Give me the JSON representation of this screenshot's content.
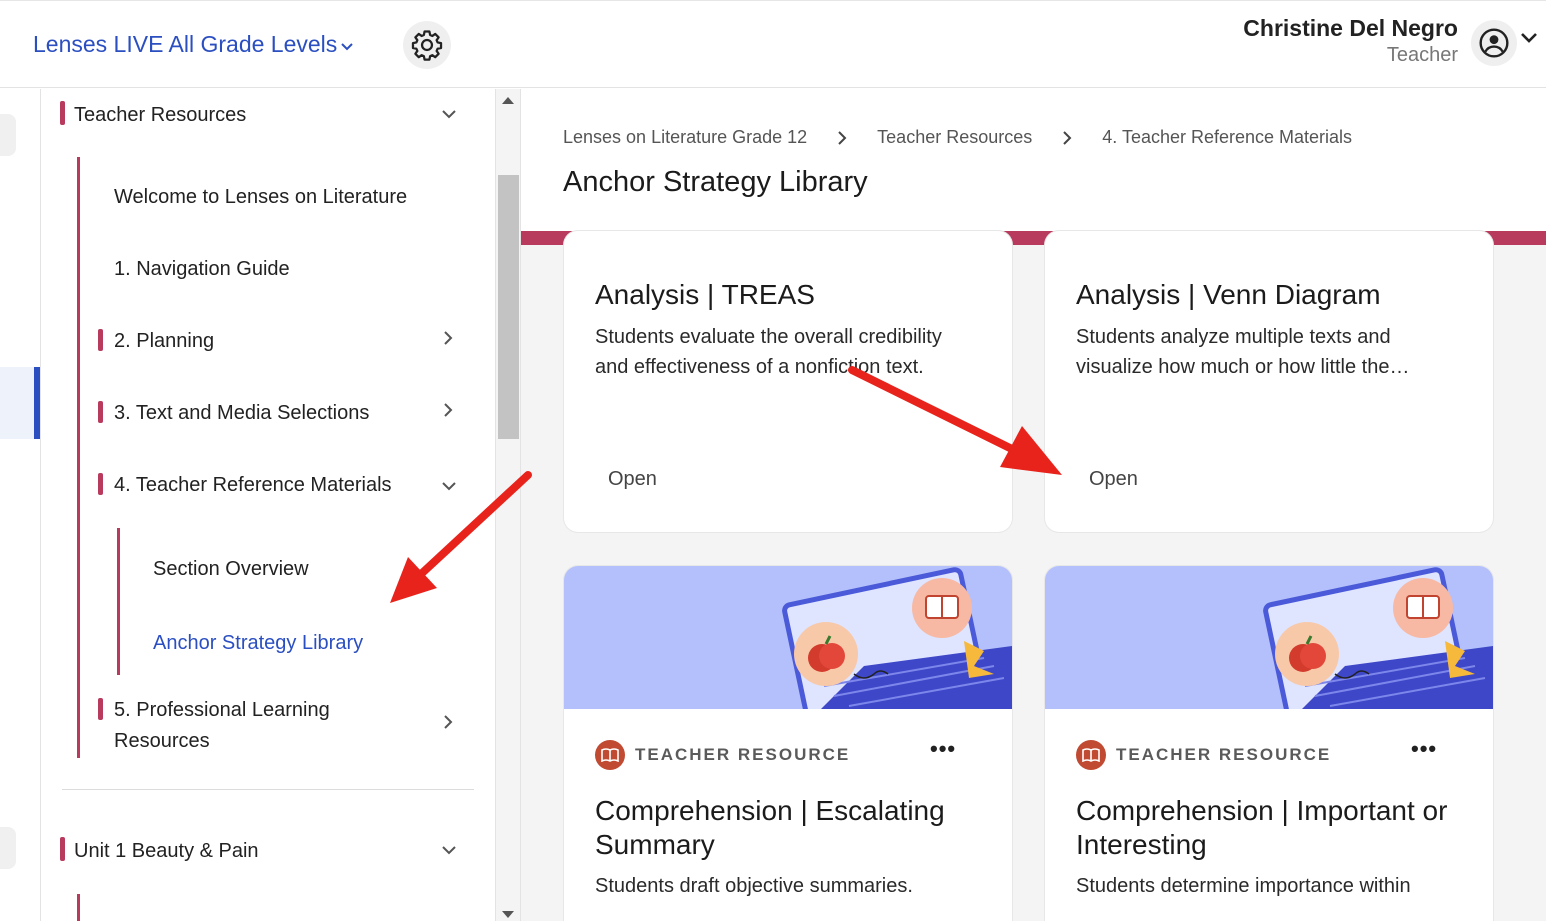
{
  "header": {
    "program_label": "Lenses LIVE All Grade Levels",
    "user_name": "Christine Del Negro",
    "user_role": "Teacher"
  },
  "sidebar": {
    "teacher_resources": "Teacher Resources",
    "welcome": "Welcome to Lenses on Literature",
    "navigation_guide": "1. Navigation Guide",
    "planning": "2. Planning",
    "text_media": "3. Text and Media Selections",
    "teacher_reference": "4. Teacher Reference Materials",
    "section_overview": "Section Overview",
    "anchor_strategy": "Anchor Strategy Library",
    "professional_learning_1": "5. Professional Learning",
    "professional_learning_2": "Resources",
    "unit1": "Unit 1 Beauty & Pain"
  },
  "breadcrumb": {
    "items": [
      "Lenses on Literature Grade 12",
      "Teacher Resources",
      "4. Teacher Reference Materials"
    ]
  },
  "page_title": "Anchor Strategy Library",
  "cards": [
    {
      "title": "Analysis | TREAS",
      "description_line1": "Students evaluate the overall credibility",
      "description_line2": "and effectiveness of a nonfiction text.",
      "action": "Open"
    },
    {
      "title": "Analysis | Venn Diagram",
      "description_line1": "Students analyze multiple texts and",
      "description_line2": "visualize how much or how little the…",
      "action": "Open"
    },
    {
      "tag": "TEACHER RESOURCE",
      "more": "•••",
      "title_line1": "Comprehension | Escalating",
      "title_line2": "Summary",
      "description_line1": "Students draft objective summaries."
    },
    {
      "tag": "TEACHER RESOURCE",
      "more": "•••",
      "title_line1": "Comprehension | Important or",
      "title_line2": "Interesting",
      "description_line1": "Students determine importance within"
    }
  ],
  "colors": {
    "brand_blue": "#2b4fc1",
    "accent_red": "#b83b5e",
    "banner_blue": "#b3c0fb",
    "annotation_arrow": "#e8231b"
  }
}
